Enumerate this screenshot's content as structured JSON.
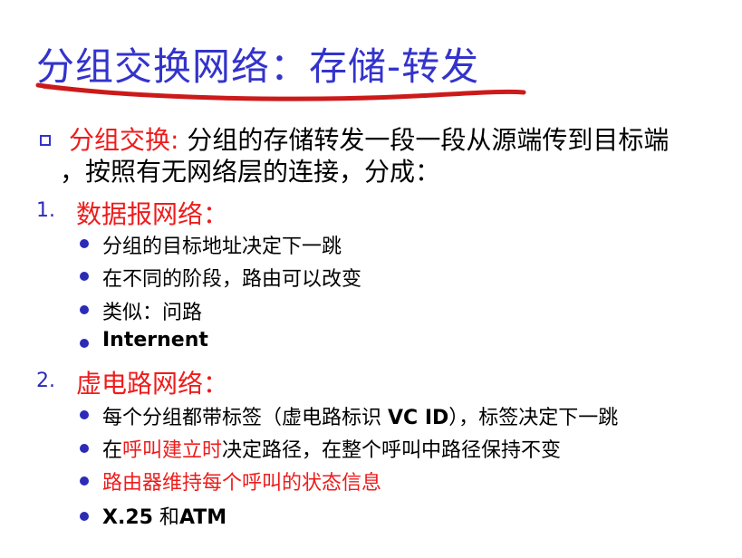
{
  "slide": {
    "title": "分组交换网络：存储-转发",
    "intro": {
      "term": "分组交换:",
      "line1_rest": " 分组的存储转发一段一段从源端传到目标端",
      "line2": "，按照有无网络层的连接，分成："
    },
    "sections": [
      {
        "number": "1.",
        "heading": "数据报网络：",
        "items": [
          "分组的目标地址决定下一跳",
          "在不同的阶段，路由可以改变",
          "类似：问路",
          "Internent"
        ]
      },
      {
        "number": "2.",
        "heading": "虚电路网络：",
        "items": [
          {
            "pre": "每个分组都带标签（虚电路标识 ",
            "latin": "VC ID",
            "post": "），标签决定下一跳"
          },
          {
            "pre": "在",
            "red": "呼叫建立时",
            "post": "决定路径，在整个呼叫中路径保持不变"
          },
          "路由器维持每个呼叫的状态信息",
          {
            "latin1": "X.25",
            "mid": " 和",
            "latin2": "ATM"
          }
        ]
      }
    ]
  },
  "colors": {
    "title": "#3333cc",
    "accent_red": "#ee1c1c",
    "bullet_blue": "#2b2bb8",
    "text": "#000000"
  },
  "icons": {
    "intro_bullet": "hollow-square",
    "item_bullet": "filled-circle",
    "title_underline": "red-brush-stroke"
  }
}
